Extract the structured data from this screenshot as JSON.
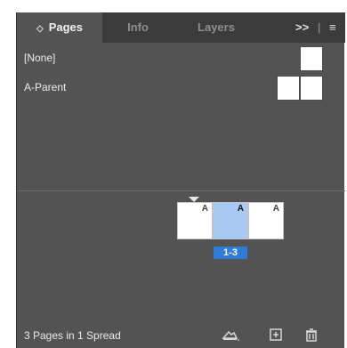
{
  "tabs": [
    {
      "label": "Pages",
      "active": true
    },
    {
      "label": "Info",
      "active": false
    },
    {
      "label": "Layers",
      "active": false
    }
  ],
  "toolbar_icons": [
    "collapse-arrows-icon",
    "more-panels-icon",
    "panel-menu-icon"
  ],
  "more_panels_glyph": ">>",
  "parents": [
    {
      "label": "[None]",
      "thumbnails": 1
    },
    {
      "label": "A-Parent",
      "thumbnails": 2
    }
  ],
  "spread": {
    "pages": [
      {
        "prefix": "A",
        "selected": false
      },
      {
        "prefix": "A",
        "selected": true
      },
      {
        "prefix": "A",
        "selected": false
      }
    ],
    "label": "1-3"
  },
  "footer": {
    "status": "3 Pages in 1 Spread",
    "icons": [
      "edit-page-size-icon",
      "new-page-icon",
      "delete-icon"
    ]
  },
  "colors": {
    "panel": "#535353",
    "tabbar": "#3b3b3b",
    "selection": "#2f7bd8",
    "selected_page": "#a8c8f4"
  }
}
